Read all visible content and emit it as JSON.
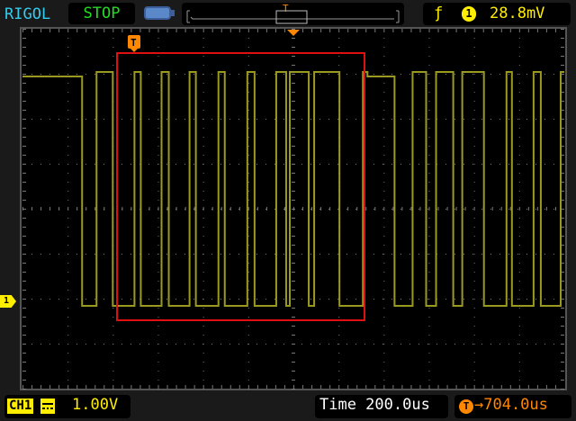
{
  "header": {
    "brand": "RIGOL",
    "run_state": "STOP",
    "battery_icon": "battery-icon",
    "trigger": {
      "slope_icon": "rising-edge-icon",
      "source": "1",
      "level": "28.8mV"
    },
    "memory_trigger_marker": "T"
  },
  "screen": {
    "trigger_position_marker": "T",
    "channel_marker": "1"
  },
  "footer": {
    "channel": "CH1",
    "coupling_icon": "dc-coupling-icon",
    "vertical_scale": "1.00V",
    "timebase": "Time 200.0us",
    "trigger_offset_icon": "T",
    "trigger_offset": "→704.0us"
  },
  "colors": {
    "ch1": "#9a9a20",
    "brand": "#33ccee",
    "stop": "#22dd22",
    "trigger": "#ff8800",
    "zoom_box": "#e01010"
  },
  "chart_data": {
    "type": "line",
    "title": "CH1 waveform",
    "x_units": "us (relative to screen center)",
    "y_units": "V",
    "xlim": [
      -1200,
      1200
    ],
    "time_per_div_us": 200,
    "volts_per_div": 1.0,
    "transitions": [
      [
        -1204,
        5.0
      ],
      [
        -936,
        -0.1
      ],
      [
        -872,
        5.1
      ],
      [
        -800,
        -0.1
      ],
      [
        -704,
        5.1
      ],
      [
        -676,
        -0.1
      ],
      [
        -584,
        5.1
      ],
      [
        -552,
        -0.1
      ],
      [
        -460,
        5.1
      ],
      [
        -432,
        -0.1
      ],
      [
        -332,
        5.1
      ],
      [
        -304,
        -0.1
      ],
      [
        -204,
        5.1
      ],
      [
        -172,
        -0.1
      ],
      [
        -76,
        5.1
      ],
      [
        -32,
        -0.1
      ],
      [
        -16,
        5.1
      ],
      [
        68,
        -0.1
      ],
      [
        92,
        5.1
      ],
      [
        204,
        -0.1
      ],
      [
        308,
        5.1
      ],
      [
        328,
        5.0
      ],
      [
        448,
        -0.1
      ],
      [
        528,
        5.1
      ],
      [
        588,
        -0.1
      ],
      [
        632,
        5.1
      ],
      [
        708,
        -0.1
      ],
      [
        748,
        5.1
      ],
      [
        844,
        -0.1
      ],
      [
        944,
        5.1
      ],
      [
        968,
        -0.1
      ],
      [
        1064,
        5.1
      ],
      [
        1096,
        -0.1
      ],
      [
        1184,
        5.1
      ]
    ]
  }
}
